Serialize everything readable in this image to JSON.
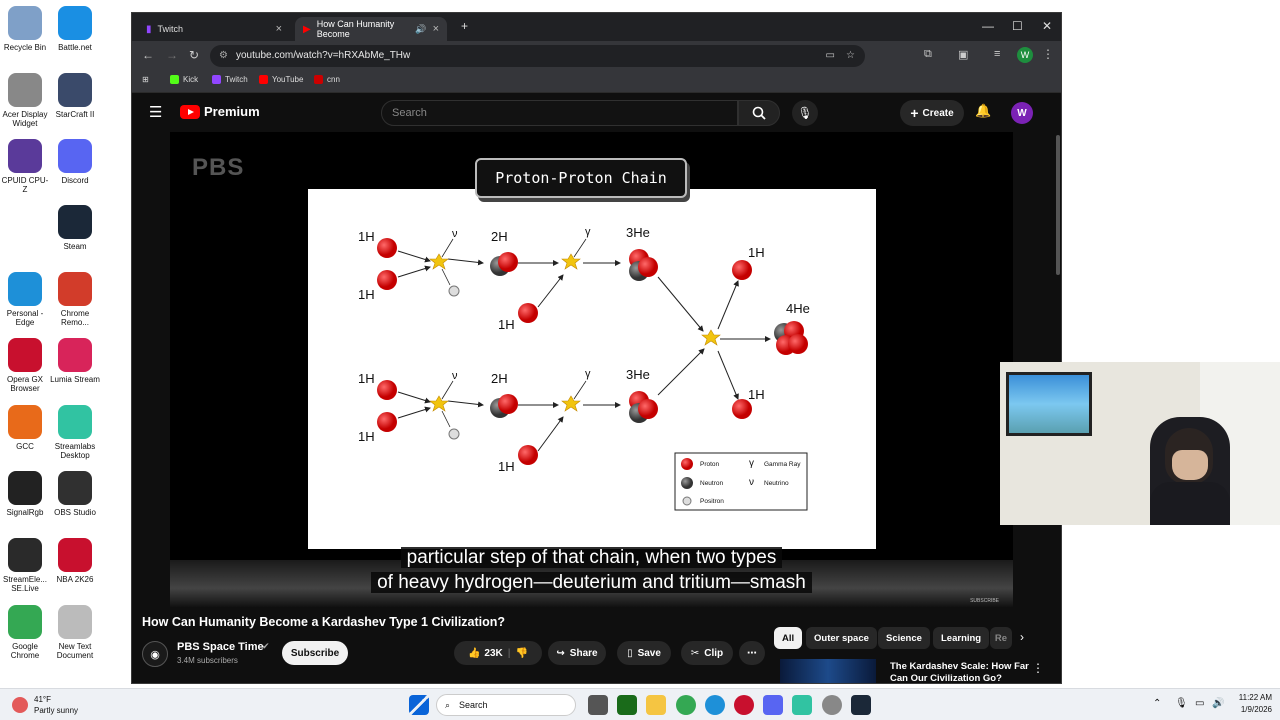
{
  "desktop": {
    "icons": [
      {
        "label": "Recycle Bin",
        "color": "#7fa0c8"
      },
      {
        "label": "Battle.net",
        "color": "#1a8fe3"
      },
      {
        "label": "Acer Display Widget",
        "color": "#888888"
      },
      {
        "label": "StarCraft II",
        "color": "#3a4a6a"
      },
      {
        "label": "CPUID CPU-Z",
        "color": "#5a3a9a"
      },
      {
        "label": "Discord",
        "color": "#5865f2"
      },
      {
        "label": "Steam",
        "color": "#1b2838"
      },
      {
        "label": "Personal - Edge",
        "color": "#1e90d8"
      },
      {
        "label": "Chrome Remo...",
        "color": "#d23c2a"
      },
      {
        "label": "Opera GX Browser",
        "color": "#c8102e"
      },
      {
        "label": "Lumia Stream",
        "color": "#d8245a"
      },
      {
        "label": "GCC",
        "color": "#e86a1a"
      },
      {
        "label": "Streamlabs Desktop",
        "color": "#31c3a2"
      },
      {
        "label": "SignalRgb",
        "color": "#222222"
      },
      {
        "label": "OBS Studio",
        "color": "#303030"
      },
      {
        "label": "StreamEle... SE.Live",
        "color": "#2a2a2a"
      },
      {
        "label": "NBA 2K26",
        "color": "#c8102e"
      },
      {
        "label": "Google Chrome",
        "color": "#34a853"
      },
      {
        "label": "New Text Document",
        "color": "#bbbbbb"
      }
    ]
  },
  "browser": {
    "tabs": [
      {
        "label": "Twitch"
      },
      {
        "label": "How Can Humanity Become"
      }
    ],
    "url": "youtube.com/watch?v=hRXAbMe_THw",
    "bookmarks": [
      "Kick",
      "Twitch",
      "YouTube",
      "cnn"
    ],
    "profile_initial": "W"
  },
  "youtube": {
    "brand": "Premium",
    "search_placeholder": "Search",
    "create_label": "Create",
    "avatar_initial": "W",
    "video": {
      "watermark": "PBS",
      "chart_title": "Proton-Proton Chain",
      "caption_line1": "particular step of that chain, when two types",
      "caption_line2": "of heavy hydrogen—deuterium and tritium—smash",
      "subscribe_watermark": "SUBSCRIBE",
      "diagram": {
        "h1": "1H",
        "h2": "2H",
        "he3": "3He",
        "he4": "4He",
        "nu": "ν",
        "gamma": "γ",
        "legend": {
          "proton": "Proton",
          "neutron": "Neutron",
          "positron": "Positron",
          "gamma_ray": "Gamma Ray",
          "neutrino": "Neutrino"
        }
      }
    },
    "title": "How Can Humanity Become a Kardashev Type 1 Civilization?",
    "channel": {
      "name": "PBS Space Time",
      "subscribers": "3.4M subscribers",
      "subscribe_label": "Subscribe"
    },
    "actions": {
      "likes": "23K",
      "share": "Share",
      "save": "Save",
      "clip": "Clip"
    },
    "chips": [
      "All",
      "Outer space",
      "Science",
      "Learning",
      "Re"
    ],
    "recommended": {
      "title_line1": "The Kardashev Scale: How Far",
      "title_line2": "Can Our Civilization Go?"
    }
  },
  "taskbar": {
    "weather_temp": "41°F",
    "weather_desc": "Partly sunny",
    "search_label": "Search",
    "time": "11:22 AM",
    "date": "1/9/2026"
  }
}
